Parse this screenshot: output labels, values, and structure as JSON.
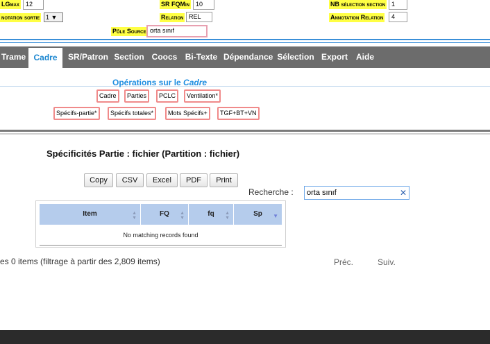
{
  "params": {
    "lgmax_label": "LGmax",
    "lgmax_value": "12",
    "sr_fqmin_label": "SR FQMin",
    "sr_fqmin_value": "10",
    "nb_selection_label": "NB sélection section",
    "nb_selection_value": "1",
    "annotation_sortie_label": "notation sortie",
    "annotation_sortie_value": "1 ▼",
    "relation_label": "Relation",
    "relation_value": "REL",
    "annotation_relation_label": "Annotation Relation",
    "annotation_relation_value": "4",
    "pole_source_label": "Pôle Source",
    "pole_source_value": "orta sınıf"
  },
  "nav": {
    "items": [
      "Trame",
      "Cadre",
      "SR/Patron",
      "Section",
      "Coocs",
      "Bi-Texte",
      "Dépendance",
      "Sélection",
      "Export",
      "Aide"
    ],
    "active": "Cadre"
  },
  "operations": {
    "title_prefix": "Opérations sur le",
    "title_em": "Cadre",
    "row1": [
      "Cadre",
      "Parties",
      "PCLC",
      "Ventilation*"
    ],
    "row2": [
      "Spécifs-partie*",
      "Spécifs totales*",
      "Mots Spécifs+",
      "TGF+BT+VN"
    ]
  },
  "results": {
    "title": "Spécificités Partie : fichier (Partition : fichier)",
    "buttons": [
      "Copy",
      "CSV",
      "Excel",
      "PDF",
      "Print"
    ],
    "search_label": "Recherche :",
    "search_value": "orta sınıf",
    "columns": [
      "Item",
      "FQ",
      "fq",
      "Sp"
    ],
    "empty_message": "No matching records found",
    "info": "es 0 items (filtrage à partir des 2,809 items)",
    "prev": "Préc.",
    "next": "Suiv."
  },
  "colors": {
    "nav_bg": "#6c6c6c",
    "accent_blue": "#1f8ee0",
    "label_yellow": "#ffff44",
    "op_border": "#f08a8a",
    "table_header": "#b5ccec"
  }
}
